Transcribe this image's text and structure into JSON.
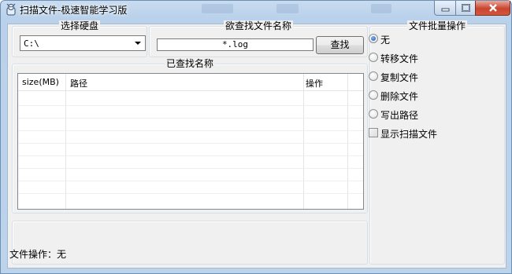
{
  "window": {
    "title": "扫描文件-极速智能学习版"
  },
  "drive_group": {
    "label": "选择硬盘",
    "selected": "C:\\"
  },
  "search_group": {
    "label": "欲查找文件名称",
    "input_value": "*.log",
    "button_label": "查找"
  },
  "results_group": {
    "label": "已查找名称",
    "columns": [
      "size(MB)",
      "路径",
      "操作"
    ]
  },
  "batch_group": {
    "label": "文件批量操作",
    "options": [
      {
        "label": "无",
        "type": "radio",
        "checked": true
      },
      {
        "label": "转移文件",
        "type": "radio",
        "checked": false
      },
      {
        "label": "复制文件",
        "type": "radio",
        "checked": false
      },
      {
        "label": "删除文件",
        "type": "radio",
        "checked": false
      },
      {
        "label": "写出路径",
        "type": "radio",
        "checked": false
      },
      {
        "label": "显示扫描文件",
        "type": "checkbox",
        "checked": false
      }
    ]
  },
  "status": {
    "text": "文件操作：无"
  }
}
